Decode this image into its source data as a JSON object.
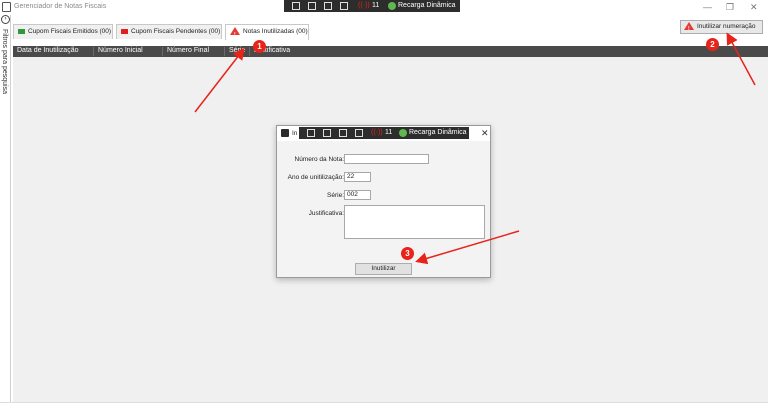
{
  "window": {
    "title": "Gerenciador de Notas Fiscais",
    "minimize": "—",
    "maximize": "❐",
    "close": "✕"
  },
  "toolbar_overlay": {
    "counter": "11",
    "recarga_label": "Recarga Dinâmica"
  },
  "sidebar": {
    "chevron": "›",
    "label": "Filtros para pesquisa"
  },
  "tabs": [
    {
      "label": "Cupom Fiscais Emitidos (00)",
      "flag_color": "#2e9a3a"
    },
    {
      "label": "Cupom Fiscais Pendentes (00)",
      "flag_color": "#e02020"
    },
    {
      "label": "Notas Inutilizadas (00)",
      "active": true
    }
  ],
  "inutilizar_button": {
    "label": "Inutilizar numeração"
  },
  "grid": {
    "columns": [
      "Data de Inutilização",
      "Número Inicial",
      "Número Final",
      "Série",
      "Justificativa"
    ]
  },
  "dialog": {
    "title": "In",
    "close": "✕",
    "fields": {
      "numero_label": "Número da Nota:",
      "numero_value": "",
      "ano_label": "Ano de unitilização:",
      "ano_value": "22",
      "serie_label": "Série:",
      "serie_value": "002",
      "justificativa_label": "Justificativa:",
      "justificativa_value": ""
    },
    "submit_label": "Inutilizar"
  },
  "annotations": [
    {
      "number": "1"
    },
    {
      "number": "2"
    },
    {
      "number": "3"
    }
  ],
  "colors": {
    "accent_red": "#e8231a",
    "header_dark": "#4a4a4a",
    "overlay_dark": "#2d2d2d"
  }
}
